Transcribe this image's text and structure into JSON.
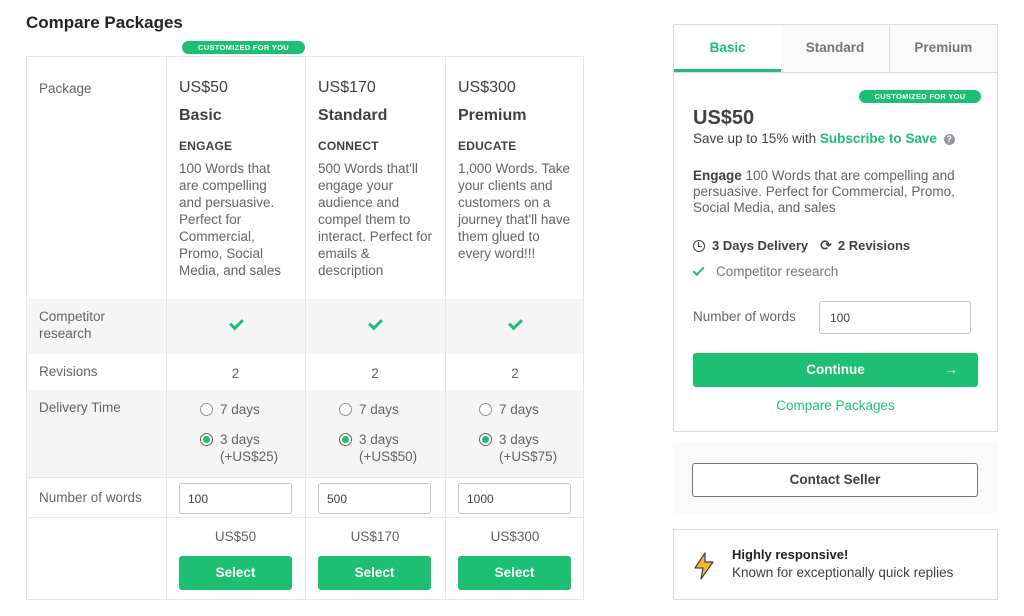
{
  "page": {
    "title": "Compare Packages"
  },
  "compare": {
    "badge": "CUSTOMIZED FOR YOU",
    "labels": {
      "package": "Package",
      "competitor": "Competitor research",
      "revisions": "Revisions",
      "delivery": "Delivery Time",
      "words": "Number of words"
    },
    "packages": [
      {
        "price": "US$50",
        "name": "Basic",
        "tag": "ENGAGE",
        "description": "100 Words that are compelling and persuasive. Perfect for Commercial, Promo, Social Media, and sales",
        "competitor_research": true,
        "revisions": "2",
        "delivery_options": [
          {
            "label": "7 days",
            "selected": false
          },
          {
            "label": "3 days",
            "extra": "(+US$25)",
            "selected": true
          }
        ],
        "words": "100",
        "total": "US$50",
        "select_label": "Select"
      },
      {
        "price": "US$170",
        "name": "Standard",
        "tag": "CONNECT",
        "description": "500 Words that'll engage your audience and compel them to interact. Perfect for emails & description",
        "competitor_research": true,
        "revisions": "2",
        "delivery_options": [
          {
            "label": "7 days",
            "selected": false
          },
          {
            "label": "3 days",
            "extra": "(+US$50)",
            "selected": true
          }
        ],
        "words": "500",
        "total": "US$170",
        "select_label": "Select"
      },
      {
        "price": "US$300",
        "name": "Premium",
        "tag": "EDUCATE",
        "description": "1,000 Words. Take your clients and customers on a journey that'll have them glued to every word!!!",
        "competitor_research": true,
        "revisions": "2",
        "delivery_options": [
          {
            "label": "7 days",
            "selected": false
          },
          {
            "label": "3 days",
            "extra": "(+US$75)",
            "selected": true
          }
        ],
        "words": "1000",
        "total": "US$300",
        "select_label": "Select"
      }
    ]
  },
  "sidebar": {
    "tabs": [
      {
        "label": "Basic",
        "active": true
      },
      {
        "label": "Standard",
        "active": false
      },
      {
        "label": "Premium",
        "active": false
      }
    ],
    "badge": "CUSTOMIZED FOR YOU",
    "price": "US$50",
    "save_text": "Save up to 15% with",
    "save_link": "Subscribe to Save",
    "help_icon": "?",
    "desc_bold": "Engage",
    "desc_text": "100 Words that are compelling and persuasive. Perfect for Commercial, Promo, Social Media, and sales",
    "delivery": "3 Days Delivery",
    "revisions": "2 Revisions",
    "feature": "Competitor research",
    "words_label": "Number of words",
    "words_value": "100",
    "continue_label": "Continue",
    "continue_arrow": "→",
    "compare_link": "Compare Packages",
    "refresh_glyph": "⟳"
  },
  "contact": {
    "label": "Contact Seller"
  },
  "responsive": {
    "title": "Highly responsive!",
    "subtitle": "Known for exceptionally quick replies"
  },
  "colors": {
    "accent": "#1dbf73",
    "text": "#404145",
    "muted": "#62646a",
    "shade": "#f5f5f5",
    "bolt": "#f7b734"
  }
}
